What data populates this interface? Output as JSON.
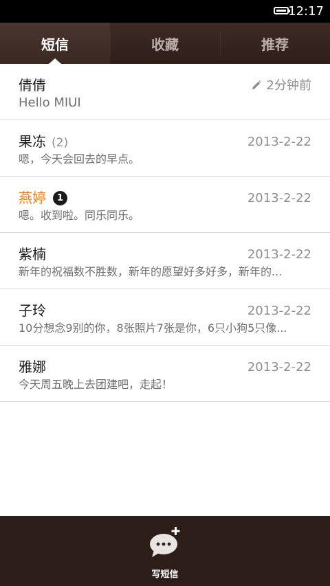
{
  "status_bar": {
    "time": "12:17",
    "battery_icon": "battery-icon"
  },
  "tabs": [
    {
      "label": "短信",
      "active": true
    },
    {
      "label": "收藏",
      "active": false
    },
    {
      "label": "推荐",
      "active": false
    }
  ],
  "messages": [
    {
      "name": "倩倩",
      "count": "",
      "unread_badge": "",
      "time": "2分钟前",
      "draft": true,
      "preview": "Hello MIUI"
    },
    {
      "name": "果冻",
      "count": "(2)",
      "unread_badge": "",
      "time": "2013-2-22",
      "draft": false,
      "preview": "嗯，今天会回去的早点。"
    },
    {
      "name": "燕婷",
      "count": "",
      "unread_badge": "1",
      "time": "2013-2-22",
      "draft": false,
      "preview": "嗯。收到啦。同乐同乐。"
    },
    {
      "name": "紫楠",
      "count": "",
      "unread_badge": "",
      "time": "2013-2-22",
      "draft": false,
      "preview": "新年的祝福数不胜数，新年的愿望好多好多，新年的..."
    },
    {
      "name": "子玲",
      "count": "",
      "unread_badge": "",
      "time": "2013-2-22",
      "draft": false,
      "preview": "10分想念9别的你，8张照片7张是你，6只小狗5只像..."
    },
    {
      "name": "雅娜",
      "count": "",
      "unread_badge": "",
      "time": "2013-2-22",
      "draft": false,
      "preview": "今天周五晚上去团建吧，走起！"
    }
  ],
  "bottom_bar": {
    "compose_label": "写短信",
    "compose_icon": "compose-message-icon"
  },
  "colors": {
    "unread_name": "#f07c13",
    "tab_bar": "#2e1e19",
    "bottom_bar": "#2d1d19",
    "compose_bubble": "#e8e4e2"
  }
}
